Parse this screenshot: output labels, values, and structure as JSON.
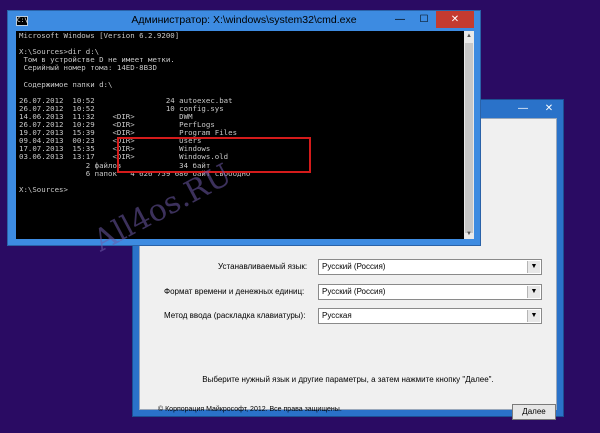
{
  "setup": {
    "controls": [
      "—",
      "✕"
    ],
    "language_label": "Устанавливаемый язык:",
    "language_value": "Русский (Россия)",
    "time_label": "Формат времени и денежных единиц:",
    "time_value": "Русский (Россия)",
    "keyboard_label": "Метод ввода (раскладка клавиатуры):",
    "keyboard_value": "Русская",
    "hint": "Выберите нужный язык и другие параметры, а затем нажмите кнопку \"Далее\".",
    "copyright": "© Корпорация Майкрософт, 2012. Все права защищены.",
    "next_label": "Далее"
  },
  "cmd": {
    "title": "Администратор: X:\\windows\\system32\\cmd.exe",
    "icon_text": "C:\\",
    "controls": {
      "minimize": "—",
      "maximize": "☐",
      "close": "✕"
    },
    "lines": [
      "Microsoft Windows [Version 6.2.9200]",
      "",
      "X:\\Sources>dir d:\\",
      " Том в устройстве D не имеет метки.",
      " Серийный номер тома: 14ED-8B3D",
      "",
      " Содержимое папки d:\\",
      "",
      "26.07.2012  10:52                24 autoexec.bat",
      "26.07.2012  10:52                10 config.sys",
      "14.06.2013  11:32    <DIR>          DWM",
      "26.07.2012  10:29    <DIR>          PerfLogs",
      "19.07.2013  15:39    <DIR>          Program Files",
      "09.04.2013  00:23    <DIR>          Users",
      "17.07.2013  15:35    <DIR>          Windows",
      "03.06.2013  13:17    <DIR>          Windows.old",
      "               2 файлов             34 байт",
      "               6 папок   4 626 759 680 байт свободно",
      "",
      "X:\\Sources>"
    ]
  },
  "watermark": "All4os.RU",
  "colors": {
    "desktop": "#2a0b63",
    "highlight": "#d41b1b",
    "cmd_frame": "#3d8be1"
  }
}
